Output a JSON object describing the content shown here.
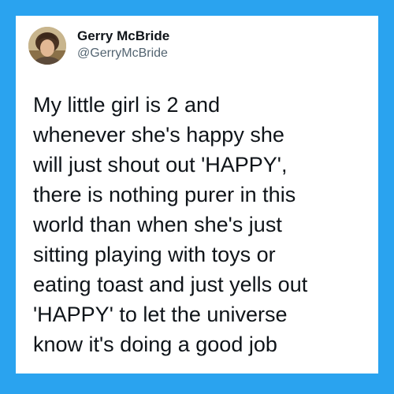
{
  "tweet": {
    "author": {
      "name": "Gerry McBride",
      "handle": "@GerryMcBride",
      "avatar_icon": "profile-photo"
    },
    "text_lines": [
      "My little girl is 2 and",
      "whenever she's happy she",
      "will just shout out 'HAPPY',",
      "there is nothing purer in this",
      "world than when she's just",
      "sitting playing with toys or",
      "eating toast and just yells out",
      "'HAPPY' to let the universe",
      "know it's doing a good job"
    ]
  },
  "colors": {
    "background": "#2aa3ef",
    "card": "#ffffff",
    "text": "#0f1419",
    "secondary_text": "#536471"
  }
}
